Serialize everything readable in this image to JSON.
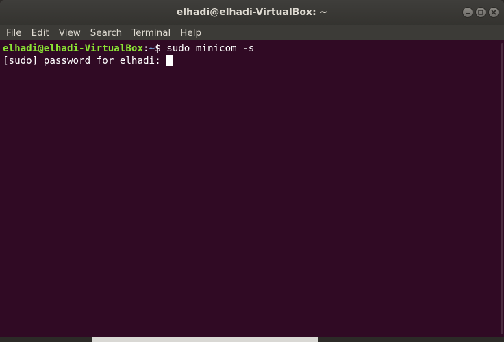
{
  "window": {
    "title": "elhadi@elhadi-VirtualBox: ~",
    "controls": [
      "minimize-icon",
      "maximize-icon",
      "close-icon"
    ]
  },
  "menu": [
    "File",
    "Edit",
    "View",
    "Search",
    "Terminal",
    "Help"
  ],
  "terminal": {
    "prompt_user": "elhadi@elhadi-VirtualBox",
    "prompt_sep": ":",
    "prompt_path": "~",
    "prompt_dollar": "$ ",
    "command": "sudo minicom -s",
    "line2": "[sudo] password for elhadi: "
  },
  "colors": {
    "terminal_bg": "#300a24",
    "prompt_user": "#8ae234",
    "prompt_path": "#729fcf",
    "titlebar": "#3c3b37"
  }
}
